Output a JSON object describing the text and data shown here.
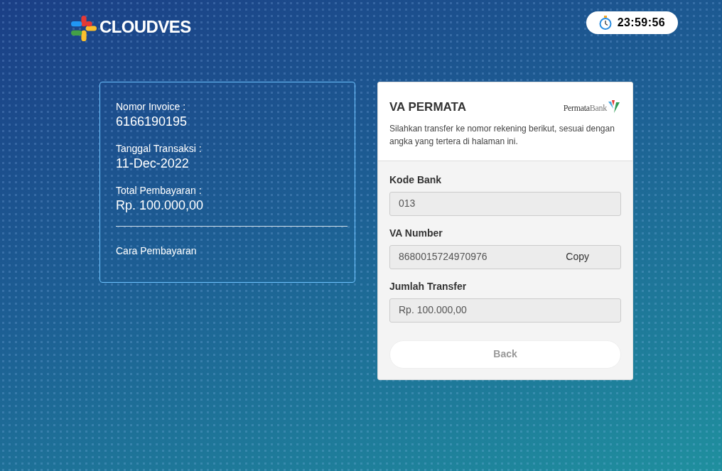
{
  "header": {
    "logo_text": "CLOUDVES",
    "timer": "23:59:56"
  },
  "invoice": {
    "fields": [
      {
        "label": "Nomor Invoice :",
        "value": "6166190195"
      },
      {
        "label": "Tanggal Transaksi :",
        "value": "11-Dec-2022"
      },
      {
        "label": "Total Pembayaran :",
        "value": "Rp. 100.000,00"
      }
    ],
    "link": "Cara Pembayaran"
  },
  "payment": {
    "title": "VA PERMATA",
    "bank_logo": {
      "first": "Permata",
      "second": "Bank"
    },
    "description": "Silahkan transfer ke nomor rekening berikut, sesuai dengan angka yang tertera di halaman ini.",
    "fields": [
      {
        "label": "Kode Bank",
        "value": "013"
      },
      {
        "label": "VA Number",
        "value": "8680015724970976",
        "action": "Copy"
      },
      {
        "label": "Jumlah Transfer",
        "value": "Rp. 100.000,00"
      }
    ],
    "button": "Back"
  }
}
